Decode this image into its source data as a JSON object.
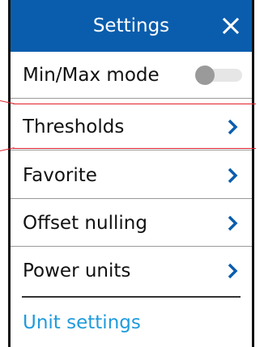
{
  "header": {
    "title": "Settings",
    "close_icon": "close-icon"
  },
  "rows": [
    {
      "label": "Min/Max mode",
      "control": "toggle",
      "toggle_on": false
    },
    {
      "label": "Thresholds",
      "control": "chevron"
    },
    {
      "label": "Favorite",
      "control": "chevron"
    },
    {
      "label": "Offset nulling",
      "control": "chevron"
    },
    {
      "label": "Power units",
      "control": "chevron"
    }
  ],
  "section_link": {
    "label": "Unit settings"
  },
  "colors": {
    "header_bg": "#0a5dad",
    "link": "#1f9bdc",
    "chevron": "#0a5dad",
    "toggle_off_knob": "#9a9a9a",
    "highlight": "#e01f2a"
  }
}
